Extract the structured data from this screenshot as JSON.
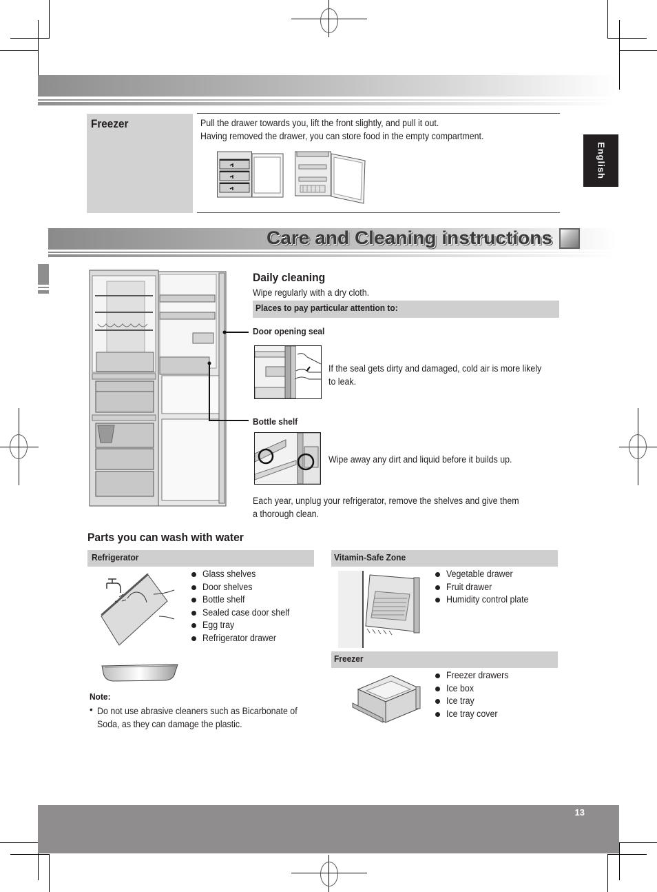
{
  "language_tab": "English",
  "freezer_row": {
    "label": "Freezer",
    "lines": [
      "Pull the drawer towards you, lift the front slightly, and pull it out.",
      "Having removed the drawer, you can store food in the empty compartment."
    ],
    "images": [
      "freezer-with-drawers-illustration",
      "freezer-without-drawers-illustration"
    ]
  },
  "section": {
    "title": "Care and Cleaning instructions"
  },
  "daily_cleaning": {
    "heading": "Daily cleaning",
    "intro": "Wipe regularly with a dry cloth.",
    "attention_bar": "Places to pay particular attention to:",
    "items": [
      {
        "title": "Door opening seal",
        "text": "If the seal gets dirty and damaged, cold air is more likely to leak."
      },
      {
        "title": "Bottle shelf",
        "text": "Wipe away any dirt and liquid before it builds up."
      }
    ],
    "yearly_note": "Each year, unplug your refrigerator, remove the shelves and give them a thorough clean."
  },
  "washable": {
    "heading": "Parts you can wash with water",
    "refrigerator": {
      "label": "Refrigerator",
      "items": [
        "Glass shelves",
        "Door shelves",
        "Bottle shelf",
        "Sealed case door shelf",
        "Egg tray",
        "Refrigerator drawer"
      ]
    },
    "vitamin_zone": {
      "label": "Vitamin-Safe Zone",
      "items": [
        "Vegetable drawer",
        "Fruit drawer",
        "Humidity control plate"
      ]
    },
    "freezer": {
      "label": "Freezer",
      "items": [
        "Freezer drawers",
        "Ice box",
        "Ice tray",
        "Ice tray cover"
      ]
    },
    "note": {
      "label": "Note:",
      "bullet": "•",
      "text": "Do not use abrasive cleaners such as Bicarbonate of Soda, as they can damage the plastic."
    }
  },
  "footer": {
    "page_number": "13"
  }
}
